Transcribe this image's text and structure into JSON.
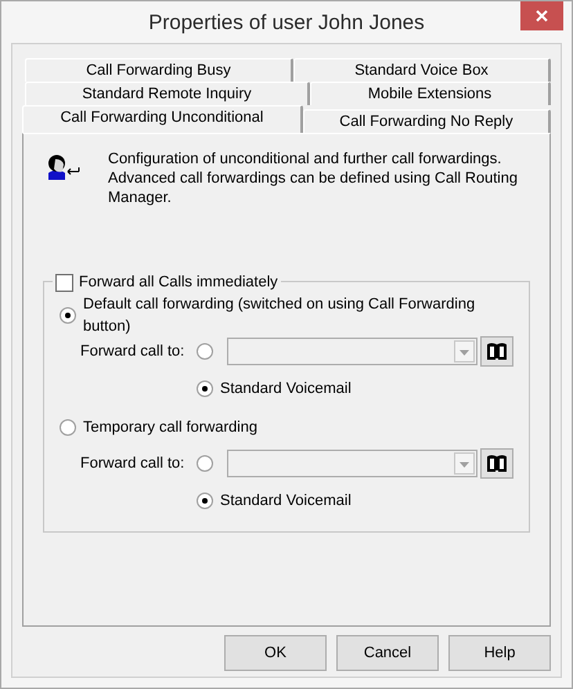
{
  "window": {
    "title": "Properties of user John Jones"
  },
  "tab_rows": [
    [
      {
        "label": "Call Forwarding Busy",
        "selected": false
      },
      {
        "label": "Standard Voice Box",
        "selected": false
      }
    ],
    [
      {
        "label": "Standard Remote Inquiry",
        "selected": false
      },
      {
        "label": "Mobile Extensions",
        "selected": false
      }
    ],
    [
      {
        "label": "Call Forwarding Unconditional",
        "selected": true
      },
      {
        "label": "Call Forwarding No Reply",
        "selected": false
      }
    ]
  ],
  "description": "Configuration of unconditional and further call forwardings. Advanced call forwardings can be defined using Call Routing Manager.",
  "forward_all": {
    "label": "Forward all Calls immediately",
    "checked": false
  },
  "options": [
    {
      "label": "Default call forwarding (switched on using Call Forwarding button)",
      "selected": true,
      "forward_label": "Forward call to:",
      "target_selected": false,
      "target_disabled": true,
      "voicemail": {
        "label": "Standard Voicemail",
        "selected": true
      }
    },
    {
      "label": "Temporary call forwarding",
      "selected": false,
      "forward_label": "Forward call to:",
      "target_selected": false,
      "target_disabled": true,
      "voicemail": {
        "label": "Standard Voicemail",
        "selected": true
      }
    }
  ],
  "buttons": [
    "OK",
    "Cancel",
    "Help"
  ]
}
